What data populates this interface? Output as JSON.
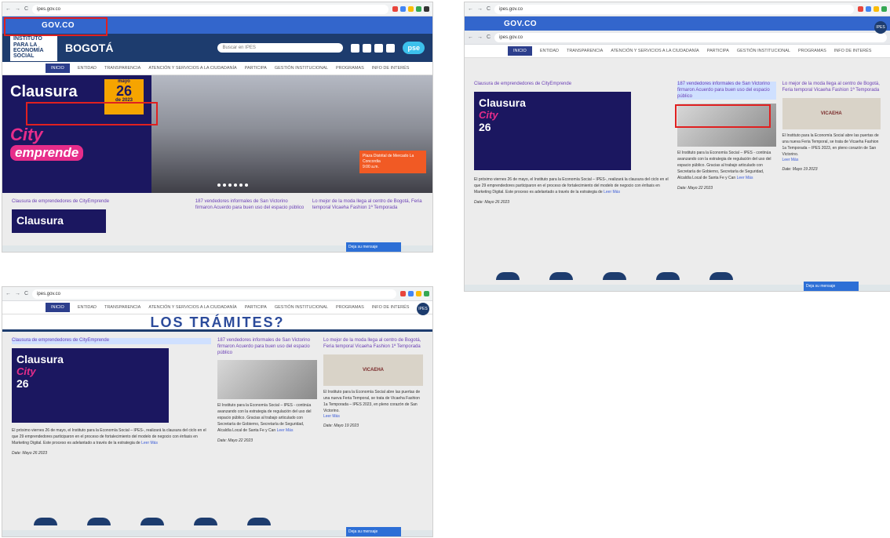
{
  "url": "ipes.gov.co",
  "gov": "GOV.CO",
  "header": {
    "entity": "INSTITUTO PARA LA ECONOMÍA SOCIAL",
    "city": "BOGOTÁ",
    "search": "Buscar en IPES",
    "pse": "pse"
  },
  "nav": [
    "INICIO",
    "ENTIDAD",
    "TRANSPARENCIA",
    "ATENCIÓN Y SERVICIOS A LA CIUDADANÍA",
    "PARTICIPA",
    "GESTIÓN INSTITUCIONAL",
    "PROGRAMAS",
    "INFO DE INTERÉS"
  ],
  "hero": {
    "title": "Clausura",
    "month": "mayo",
    "day": "26",
    "year": "de 2023",
    "city": "City",
    "emprende": "emprende",
    "event": "Plaza Distrital de Mercado La Concordia",
    "time": "9:00 a.m."
  },
  "news": [
    {
      "title": "Clausura de emprendedores de CityEmprende",
      "text": "El próximo viernes 26 de mayo, el Instituto para la Economía Social – IPES-, realizará la clausura del ciclo en el que 29 emprendedores participaron en el proceso de fortalecimiento del modelo de negocio con énfasis en Marketing Digital. Este proceso es adelantado a través de la estrategia de",
      "more": "Leer Más",
      "date": "Date: Mayo 26 2023"
    },
    {
      "title": "187 vendedores informales de San Victorino firmaron Acuerdo para buen uso del espacio público",
      "text": "El Instituto para la Economía Social – IPES - continúa avanzando con la estrategia de regulación del uso del espacio público. Gracias al trabajo articulado con Secretaría de Gobierno, Secretaría de Seguridad, Alcaldía Local de Santa Fe y Can",
      "more": "Leer Más",
      "date": "Date: Mayo 22 2023"
    },
    {
      "title": "Lo mejor de la moda llega al centro de Bogotá, Feria temporal Vicaeha Fashion 1ª Temporada",
      "text": "El Instituto para la Economía Social abre las puertas de una nueva Feria Temporal, se trata de Vicaeha Fashion 1a Temporada – IPES 2023, en pleno corazón de San Victorino.",
      "more": "Leer Más",
      "date": "Date: Mayo 19 2023"
    }
  ],
  "tramites": "LOS TRÁMITES?",
  "chat": "Deja su mensaje",
  "ipes_badge": "IPES",
  "vicaeha": "VICAEHA"
}
